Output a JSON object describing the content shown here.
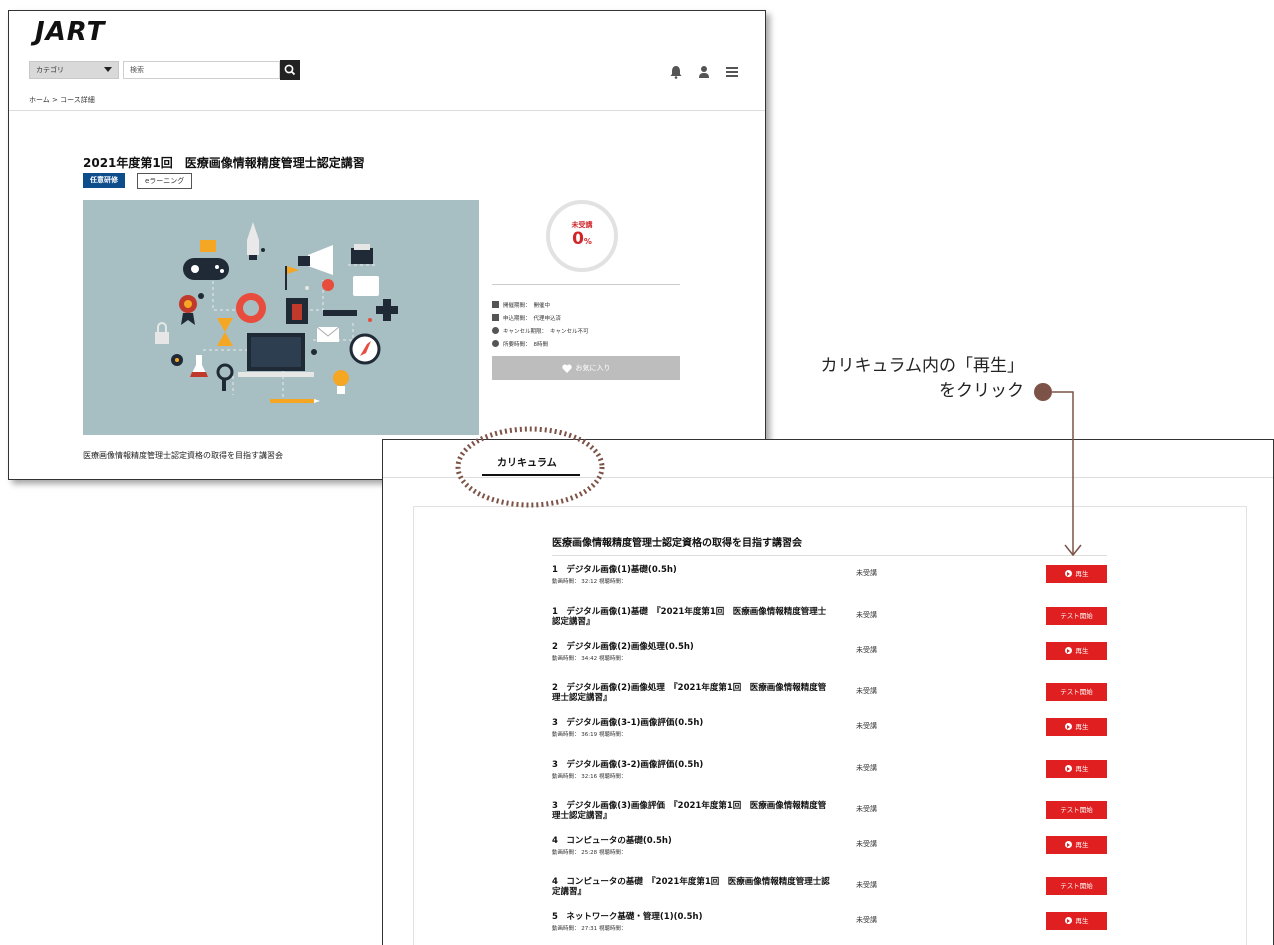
{
  "header": {
    "logo": "JART",
    "category_select": "カテゴリ",
    "search_placeholder": "検索",
    "breadcrumb": "ホーム > コース詳細"
  },
  "course": {
    "title": "2021年度第1回　医療画像情報精度管理士認定講習",
    "tag_primary": "任意研修",
    "tag_secondary": "eラーニング",
    "progress_status": "未受講",
    "progress_value": "0",
    "progress_unit": "%",
    "info": [
      {
        "label": "開催期間：",
        "value": "開催中",
        "icon": "calendar-icon"
      },
      {
        "label": "申込期間：",
        "value": "代理申込済",
        "icon": "calendar-icon"
      },
      {
        "label": "キャンセル期限：",
        "value": "キャンセル不可",
        "icon": "cancel-icon"
      },
      {
        "label": "所要時間：",
        "value": "8時間",
        "icon": "clock-icon"
      }
    ],
    "favorite_label": "お気に入り",
    "description": "医療画像情報精度管理士認定資格の取得を目指す講習会"
  },
  "annotation": {
    "line1": "カリキュラム内の「再生」",
    "line2": "をクリック"
  },
  "curriculum": {
    "tab_label": "カリキュラム",
    "heading": "医療画像情報精度管理士認定資格の取得を目指す講習会",
    "lessons": [
      {
        "title": "1　デジタル画像(1)基礎(0.5h)",
        "meta": "動画時間： 32:12 視聴時間：",
        "status": "未受講",
        "button": "再生",
        "type": "play"
      },
      {
        "title": "1　デジタル画像(1)基礎　『2021年度第1回　医療画像情報精度管理士認定講習』",
        "meta": "",
        "status": "未受講",
        "button": "テスト開始",
        "type": "test"
      },
      {
        "title": "2　デジタル画像(2)画像処理(0.5h)",
        "meta": "動画時間： 34:42 視聴時間：",
        "status": "未受講",
        "button": "再生",
        "type": "play"
      },
      {
        "title": "2　デジタル画像(2)画像処理　『2021年度第1回　医療画像情報精度管理士認定講習』",
        "meta": "",
        "status": "未受講",
        "button": "テスト開始",
        "type": "test"
      },
      {
        "title": "3　デジタル画像(3-1)画像評価(0.5h)",
        "meta": "動画時間： 36:19 視聴時間：",
        "status": "未受講",
        "button": "再生",
        "type": "play"
      },
      {
        "title": "3　デジタル画像(3-2)画像評価(0.5h)",
        "meta": "動画時間： 32:16 視聴時間：",
        "status": "未受講",
        "button": "再生",
        "type": "play"
      },
      {
        "title": "3　デジタル画像(3)画像評価　『2021年度第1回　医療画像情報精度管理士認定講習』",
        "meta": "",
        "status": "未受講",
        "button": "テスト開始",
        "type": "test"
      },
      {
        "title": "4　コンピュータの基礎(0.5h)",
        "meta": "動画時間： 25:28 視聴時間：",
        "status": "未受講",
        "button": "再生",
        "type": "play"
      },
      {
        "title": "4　コンピュータの基礎　『2021年度第1回　医療画像情報精度管理士認定講習』",
        "meta": "",
        "status": "未受講",
        "button": "テスト開始",
        "type": "test"
      },
      {
        "title": "5　ネットワーク基礎・管理(1)(0.5h)",
        "meta": "動画時間： 27:31 視聴時間：",
        "status": "未受講",
        "button": "再生",
        "type": "play"
      }
    ]
  },
  "colors": {
    "primary_tag": "#0e4d8c",
    "action_red": "#e02020",
    "progress_red": "#d0262a",
    "annotation_brown": "#7d5347"
  }
}
